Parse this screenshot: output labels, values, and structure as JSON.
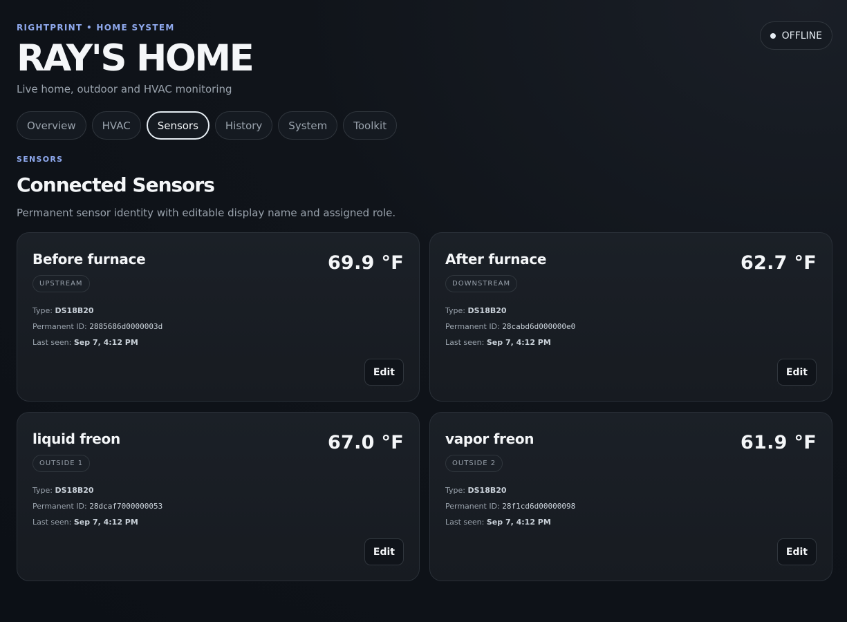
{
  "header": {
    "eyebrow": "RIGHTPRINT • HOME SYSTEM",
    "title": "RAY'S HOME",
    "subtitle": "Live home, outdoor and HVAC monitoring",
    "status": "OFFLINE"
  },
  "tabs": [
    {
      "label": "Overview",
      "active": false
    },
    {
      "label": "HVAC",
      "active": false
    },
    {
      "label": "Sensors",
      "active": true
    },
    {
      "label": "History",
      "active": false
    },
    {
      "label": "System",
      "active": false
    },
    {
      "label": "Toolkit",
      "active": false
    }
  ],
  "section": {
    "label": "SENSORS",
    "title": "Connected Sensors",
    "description": "Permanent sensor identity with editable display name and assigned role."
  },
  "labels": {
    "type": "Type:",
    "permanent_id": "Permanent ID:",
    "last_seen": "Last seen:",
    "edit": "Edit"
  },
  "sensors": [
    {
      "name": "Before furnace",
      "temp": "69.9 °F",
      "role": "UPSTREAM",
      "type": "DS18B20",
      "id": "2885686d0000003d",
      "last_seen": "Sep 7, 4:12 PM"
    },
    {
      "name": "After furnace",
      "temp": "62.7 °F",
      "role": "DOWNSTREAM",
      "type": "DS18B20",
      "id": "28cabd6d000000e0",
      "last_seen": "Sep 7, 4:12 PM"
    },
    {
      "name": "liquid freon",
      "temp": "67.0 °F",
      "role": "OUTSIDE 1",
      "type": "DS18B20",
      "id": "28dcaf7000000053",
      "last_seen": "Sep 7, 4:12 PM"
    },
    {
      "name": "vapor freon",
      "temp": "61.9 °F",
      "role": "OUTSIDE 2",
      "type": "DS18B20",
      "id": "28f1cd6d00000098",
      "last_seen": "Sep 7, 4:12 PM"
    }
  ],
  "colors": {
    "accent": "#8fa9ee",
    "background": "#0d1117",
    "card": "#1b2027",
    "text": "#f4f6f8",
    "muted": "#9aa3ad"
  }
}
